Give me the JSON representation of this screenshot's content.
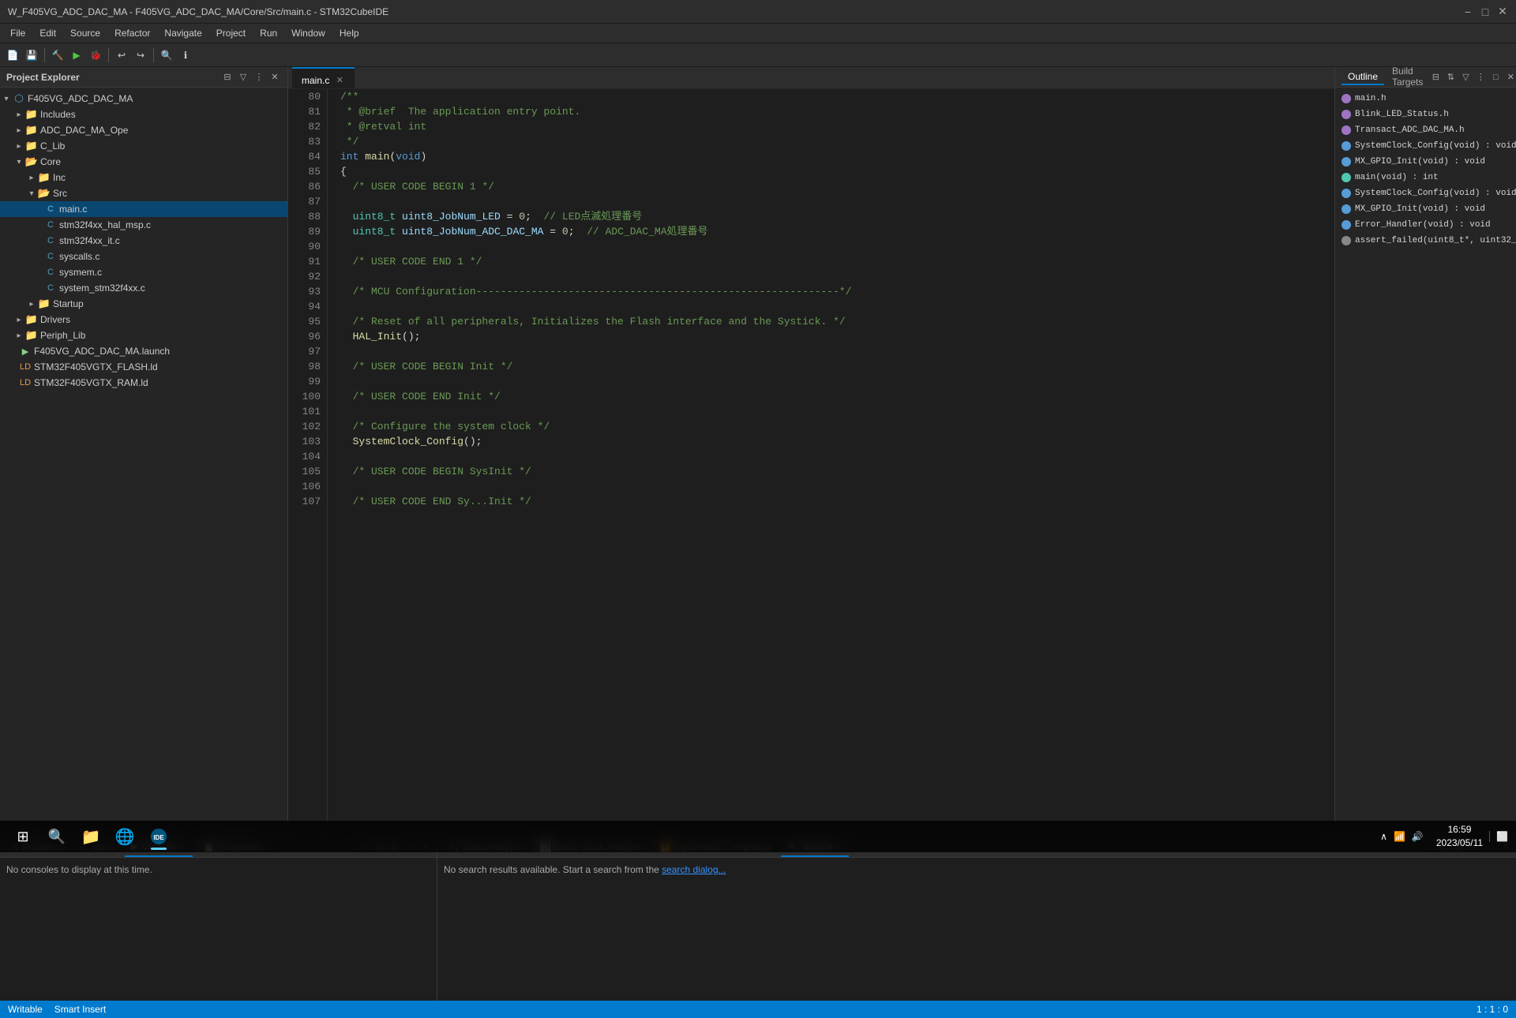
{
  "title": {
    "text": "W_F405VG_ADC_DAC_MA - F405VG_ADC_DAC_MA/Core/Src/main.c - STM32CubeIDE",
    "min_label": "−",
    "max_label": "□",
    "close_label": "✕"
  },
  "menu": {
    "items": [
      "File",
      "Edit",
      "Source",
      "Refactor",
      "Navigate",
      "Project",
      "Run",
      "Window",
      "Help"
    ]
  },
  "project_explorer": {
    "title": "Project Explorer",
    "close_icon": "✕",
    "root": {
      "name": "F405VG_ADC_DAC_MA",
      "children": [
        {
          "id": "includes",
          "label": "Includes",
          "type": "folder",
          "expanded": true,
          "depth": 1
        },
        {
          "id": "adc_dac_ma_ope",
          "label": "ADC_DAC_MA_Ope",
          "type": "folder",
          "expanded": false,
          "depth": 1
        },
        {
          "id": "c_lib",
          "label": "C_Lib",
          "type": "folder",
          "expanded": false,
          "depth": 1
        },
        {
          "id": "core",
          "label": "Core",
          "type": "folder",
          "expanded": true,
          "depth": 1,
          "children": [
            {
              "id": "inc",
              "label": "Inc",
              "type": "folder",
              "expanded": false,
              "depth": 2
            },
            {
              "id": "src",
              "label": "Src",
              "type": "folder",
              "expanded": true,
              "depth": 2,
              "children": [
                {
                  "id": "main_c",
                  "label": "main.c",
                  "type": "c-file",
                  "depth": 3,
                  "selected": true
                },
                {
                  "id": "stm32f4xx_hal_msp_c",
                  "label": "stm32f4xx_hal_msp.c",
                  "type": "c-file",
                  "depth": 3
                },
                {
                  "id": "stm32f4xx_it_c",
                  "label": "stm32f4xx_it.c",
                  "type": "c-file",
                  "depth": 3
                },
                {
                  "id": "syscalls_c",
                  "label": "syscalls.c",
                  "type": "c-file",
                  "depth": 3
                },
                {
                  "id": "sysmem_c",
                  "label": "sysmem.c",
                  "type": "c-file",
                  "depth": 3
                },
                {
                  "id": "system_stm32f4xx_c",
                  "label": "system_stm32f4xx.c",
                  "type": "c-file",
                  "depth": 3
                }
              ]
            },
            {
              "id": "startup",
              "label": "Startup",
              "type": "folder",
              "expanded": false,
              "depth": 2
            }
          ]
        },
        {
          "id": "drivers",
          "label": "Drivers",
          "type": "folder",
          "expanded": false,
          "depth": 1
        },
        {
          "id": "periph_lib",
          "label": "Periph_Lib",
          "type": "folder",
          "expanded": false,
          "depth": 1
        },
        {
          "id": "f405vg_launch",
          "label": "F405VG_ADC_DAC_MA.launch",
          "type": "launch",
          "depth": 1
        },
        {
          "id": "flash_ld",
          "label": "STM32F405VGTX_FLASH.ld",
          "type": "ld",
          "depth": 1
        },
        {
          "id": "ram_ld",
          "label": "STM32F405VGTX_RAM.ld",
          "type": "ld",
          "depth": 1
        }
      ]
    }
  },
  "editor": {
    "tab_label": "main.c",
    "lines": [
      {
        "num": 80,
        "text": "/**",
        "tokens": [
          {
            "t": "comment",
            "v": "/**"
          }
        ]
      },
      {
        "num": 81,
        "text": " * @brief  The application entry point.",
        "tokens": [
          {
            "t": "comment",
            "v": " * @brief  The application entry point."
          }
        ]
      },
      {
        "num": 82,
        "text": " * @retval int",
        "tokens": [
          {
            "t": "comment",
            "v": " * @retval int"
          }
        ]
      },
      {
        "num": 83,
        "text": " */",
        "tokens": [
          {
            "t": "comment",
            "v": " */"
          }
        ]
      },
      {
        "num": 84,
        "text": "int main(void)",
        "tokens": [
          {
            "t": "kw",
            "v": "int"
          },
          {
            "t": "op",
            "v": " "
          },
          {
            "t": "func",
            "v": "main"
          },
          {
            "t": "op",
            "v": "("
          },
          {
            "t": "kw",
            "v": "void"
          },
          {
            "t": "op",
            "v": ")"
          }
        ]
      },
      {
        "num": 85,
        "text": "{",
        "tokens": [
          {
            "t": "op",
            "v": "{"
          }
        ]
      },
      {
        "num": 86,
        "text": "  /* USER CODE BEGIN 1 */",
        "tokens": [
          {
            "t": "comment",
            "v": "  /* USER CODE BEGIN 1 */"
          }
        ]
      },
      {
        "num": 87,
        "text": "",
        "tokens": []
      },
      {
        "num": 88,
        "text": "  uint8_t uint8_JobNum_LED = 0;  // LED点滅処理番号",
        "tokens": [
          {
            "t": "type",
            "v": "  uint8_t"
          },
          {
            "t": "op",
            "v": " "
          },
          {
            "t": "macro",
            "v": "uint8_JobNum_LED"
          },
          {
            "t": "op",
            "v": " = "
          },
          {
            "t": "num",
            "v": "0"
          },
          {
            "t": "op",
            "v": ";  "
          },
          {
            "t": "comment",
            "v": "// LED点滅処理番号"
          }
        ]
      },
      {
        "num": 89,
        "text": "  uint8_t uint8_JobNum_ADC_DAC_MA = 0;  // ADC_DAC_MA処理番号",
        "tokens": [
          {
            "t": "type",
            "v": "  uint8_t"
          },
          {
            "t": "op",
            "v": " "
          },
          {
            "t": "macro",
            "v": "uint8_JobNum_ADC_DAC_MA"
          },
          {
            "t": "op",
            "v": " = "
          },
          {
            "t": "num",
            "v": "0"
          },
          {
            "t": "op",
            "v": ";  "
          },
          {
            "t": "comment",
            "v": "// ADC_DAC_MA処理番号"
          }
        ]
      },
      {
        "num": 90,
        "text": "",
        "tokens": []
      },
      {
        "num": 91,
        "text": "  /* USER CODE END 1 */",
        "tokens": [
          {
            "t": "comment",
            "v": "  /* USER CODE END 1 */"
          }
        ]
      },
      {
        "num": 92,
        "text": "",
        "tokens": []
      },
      {
        "num": 93,
        "text": "  /* MCU Configuration-----------------------------------------------------------*/",
        "tokens": [
          {
            "t": "comment",
            "v": "  /* MCU Configuration-----------------------------------------------------------*/"
          }
        ]
      },
      {
        "num": 94,
        "text": "",
        "tokens": []
      },
      {
        "num": 95,
        "text": "  /* Reset of all peripherals, Initializes the Flash interface and the Systick. */",
        "tokens": [
          {
            "t": "comment",
            "v": "  /* Reset of all peripherals, Initializes the Flash interface and the Systick. */"
          }
        ]
      },
      {
        "num": 96,
        "text": "  HAL_Init();",
        "tokens": [
          {
            "t": "func",
            "v": "  HAL_Init"
          },
          {
            "t": "op",
            "v": "();"
          }
        ]
      },
      {
        "num": 97,
        "text": "",
        "tokens": []
      },
      {
        "num": 98,
        "text": "  /* USER CODE BEGIN Init */",
        "tokens": [
          {
            "t": "comment",
            "v": "  /* USER CODE BEGIN Init */"
          }
        ]
      },
      {
        "num": 99,
        "text": "",
        "tokens": []
      },
      {
        "num": 100,
        "text": "  /* USER CODE END Init */",
        "tokens": [
          {
            "t": "comment",
            "v": "  /* USER CODE END Init */"
          }
        ]
      },
      {
        "num": 101,
        "text": "",
        "tokens": []
      },
      {
        "num": 102,
        "text": "  /* Configure the system clock */",
        "tokens": [
          {
            "t": "comment",
            "v": "  /* Configure the system clock */"
          }
        ]
      },
      {
        "num": 103,
        "text": "  SystemClock_Config();",
        "tokens": [
          {
            "t": "func",
            "v": "  SystemClock_Config"
          },
          {
            "t": "op",
            "v": "();"
          }
        ]
      },
      {
        "num": 104,
        "text": "",
        "tokens": []
      },
      {
        "num": 105,
        "text": "  /* USER CODE BEGIN SysInit */",
        "tokens": [
          {
            "t": "comment",
            "v": "  /* USER CODE BEGIN SysInit */"
          }
        ]
      },
      {
        "num": 106,
        "text": "",
        "tokens": []
      },
      {
        "num": 107,
        "text": "  /* USER CODE END Sy...Init */",
        "tokens": [
          {
            "t": "comment",
            "v": "  /* USER CODE END Sy...Init */"
          }
        ]
      }
    ]
  },
  "outline": {
    "tab_outline": "Outline",
    "tab_build_targets": "Build Targets",
    "items": [
      {
        "label": "main.h",
        "type": "h-file"
      },
      {
        "label": "Blink_LED_Status.h",
        "type": "h-file"
      },
      {
        "label": "Transact_ADC_DAC_MA.h",
        "type": "h-file"
      },
      {
        "label": "SystemClock_Config(void) : void",
        "type": "func"
      },
      {
        "label": "MX_GPIO_Init(void) : void",
        "type": "func"
      },
      {
        "label": "main(void) : int",
        "type": "func-green"
      },
      {
        "label": "SystemClock_Config(void) : void",
        "type": "func"
      },
      {
        "label": "MX_GPIO_Init(void) : void",
        "type": "func"
      },
      {
        "label": "Error_Handler(void) : void",
        "type": "func"
      },
      {
        "label": "assert_failed(uint8_t*, uint32_t) : void",
        "type": "func-grey"
      }
    ]
  },
  "bottom_left": {
    "tabs": [
      {
        "label": "Problems",
        "icon": "⚠"
      },
      {
        "label": "Tasks",
        "icon": "☑"
      },
      {
        "label": "Console",
        "icon": "▶",
        "active": true,
        "closeable": true
      },
      {
        "label": "Properties",
        "icon": "📋"
      }
    ],
    "console_text": "No consoles to display at this time."
  },
  "bottom_right": {
    "tabs": [
      {
        "label": "Build Analyzer",
        "icon": "🔨"
      },
      {
        "label": "Static Stack Analyzer",
        "icon": "📊"
      },
      {
        "label": "Cyclomatic Complexity",
        "icon": "🔁"
      },
      {
        "label": "Search",
        "icon": "🔍",
        "active": true,
        "closeable": true
      }
    ],
    "search_text": "No search results available. Start a search from the ",
    "search_link": "search dialog...",
    "search_button_label": "Search"
  },
  "status_bar": {
    "writable": "Writable",
    "smart_insert": "Smart Insert",
    "position": "1 : 1 : 0"
  },
  "taskbar": {
    "start_icon": "⊞",
    "apps": [
      {
        "label": "Search",
        "icon": "🔍"
      },
      {
        "label": "File Explorer",
        "icon": "📁"
      },
      {
        "label": "Edge",
        "icon": "🌐"
      },
      {
        "label": "STM32CubeIDE",
        "icon": "🔵",
        "active": true
      }
    ],
    "time": "16:59",
    "date": "2023/05/11"
  }
}
